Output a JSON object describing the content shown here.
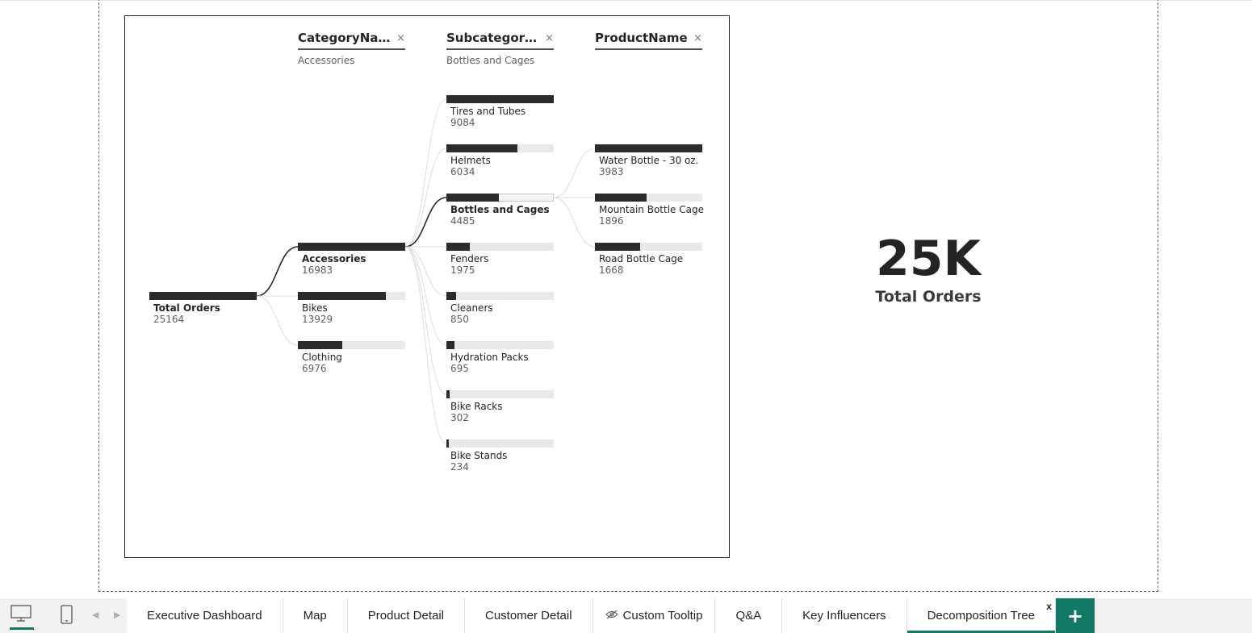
{
  "decomposition_tree": {
    "columns": [
      {
        "title": "CategoryName",
        "filter": "Accessories",
        "close": "×"
      },
      {
        "title": "Subcategory...",
        "filter": "Bottles and Cages",
        "close": "×"
      },
      {
        "title": "ProductName",
        "filter": "",
        "close": "×"
      }
    ],
    "root": {
      "label": "Total Orders",
      "value": "25164"
    },
    "categories": [
      {
        "label": "Accessories",
        "value": "16983",
        "fraction": 1.0,
        "selected": true
      },
      {
        "label": "Bikes",
        "value": "13929",
        "fraction": 0.82
      },
      {
        "label": "Clothing",
        "value": "6976",
        "fraction": 0.41
      }
    ],
    "subcategories": [
      {
        "label": "Tires and Tubes",
        "value": "9084",
        "fraction": 1.0
      },
      {
        "label": "Helmets",
        "value": "6034",
        "fraction": 0.66
      },
      {
        "label": "Bottles and Cages",
        "value": "4485",
        "fraction": 0.49,
        "selected": true
      },
      {
        "label": "Fenders",
        "value": "1975",
        "fraction": 0.22
      },
      {
        "label": "Cleaners",
        "value": "850",
        "fraction": 0.09
      },
      {
        "label": "Hydration Packs",
        "value": "695",
        "fraction": 0.077
      },
      {
        "label": "Bike Racks",
        "value": "302",
        "fraction": 0.033
      },
      {
        "label": "Bike Stands",
        "value": "234",
        "fraction": 0.026
      }
    ],
    "products": [
      {
        "label": "Water Bottle - 30 oz.",
        "value": "3983",
        "fraction": 1.0
      },
      {
        "label": "Mountain Bottle Cage",
        "value": "1896",
        "fraction": 0.48
      },
      {
        "label": "Road Bottle Cage",
        "value": "1668",
        "fraction": 0.42
      }
    ]
  },
  "kpi": {
    "value": "25K",
    "label": "Total Orders"
  },
  "bottom_bar": {
    "tabs": [
      {
        "label": "Executive Dashboard"
      },
      {
        "label": "Map"
      },
      {
        "label": "Product Detail"
      },
      {
        "label": "Customer Detail"
      },
      {
        "label": "Custom Tooltip",
        "hidden": true
      },
      {
        "label": "Q&A"
      },
      {
        "label": "Key Influencers"
      },
      {
        "label": "Decomposition Tree",
        "active": true
      }
    ],
    "close_tab": "x",
    "add_page": "+"
  },
  "colors": {
    "accent": "#117865",
    "bar": "#2b2b2b",
    "bar_bg": "#e9e9e9"
  }
}
